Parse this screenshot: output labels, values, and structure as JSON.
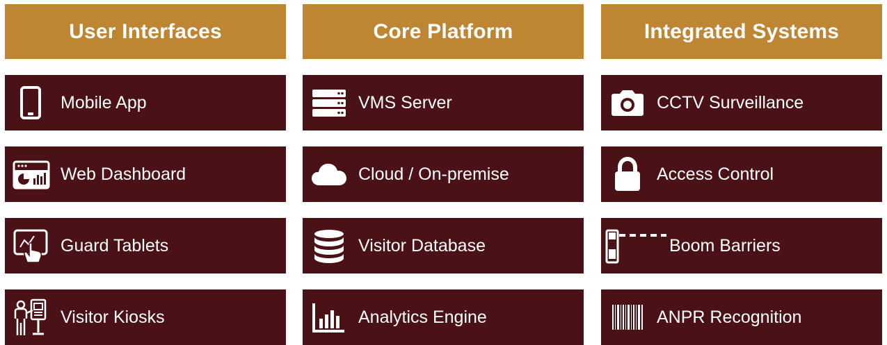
{
  "columns": [
    {
      "title": "User Interfaces",
      "items": [
        {
          "label": "Mobile App",
          "icon": "smartphone-icon"
        },
        {
          "label": "Web Dashboard",
          "icon": "dashboard-icon"
        },
        {
          "label": "Guard Tablets",
          "icon": "tablet-touch-icon"
        },
        {
          "label": "Visitor Kiosks",
          "icon": "kiosk-icon"
        }
      ]
    },
    {
      "title": "Core Platform",
      "items": [
        {
          "label": "VMS Server",
          "icon": "server-icon"
        },
        {
          "label": "Cloud / On-premise",
          "icon": "cloud-icon"
        },
        {
          "label": "Visitor Database",
          "icon": "database-icon"
        },
        {
          "label": "Analytics Engine",
          "icon": "bar-chart-icon"
        }
      ]
    },
    {
      "title": "Integrated Systems",
      "items": [
        {
          "label": "CCTV Surveillance",
          "icon": "camera-icon"
        },
        {
          "label": "Access Control",
          "icon": "lock-icon"
        },
        {
          "label": "Boom Barriers",
          "icon": "boom-barrier-icon"
        },
        {
          "label": "ANPR Recognition",
          "icon": "barcode-icon"
        }
      ]
    }
  ],
  "colors": {
    "header_bg": "#BE8533",
    "item_bg": "#4A1216",
    "text": "#FFFFFF"
  }
}
